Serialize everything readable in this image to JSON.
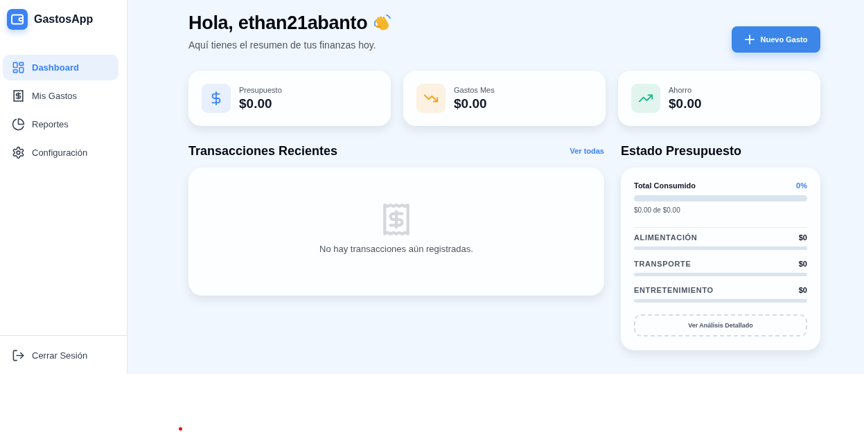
{
  "sidebar": {
    "app_name": "GastosApp",
    "items": [
      {
        "kind": "dashboard",
        "label": "Dashboard",
        "selected": true
      },
      {
        "kind": "expenses",
        "label": "Mis Gastos",
        "selected": false
      },
      {
        "kind": "reports",
        "label": "Reportes",
        "selected": false
      },
      {
        "kind": "settings",
        "label": "Configuración",
        "selected": false
      }
    ],
    "logout": {
      "label": "Cerrar Sesión"
    }
  },
  "header": {
    "greeting": "Hola, ethan21abanto",
    "subtitle": "Aquí tienes el resumen de tus finanzas hoy.",
    "new_button": "Nuevo Gasto"
  },
  "stats": [
    {
      "kind": "budget",
      "label": "Presupuesto",
      "value": "$0.00"
    },
    {
      "kind": "expenses",
      "label": "Gastos Mes",
      "value": "$0.00"
    },
    {
      "kind": "savings",
      "label": "Ahorro",
      "value": "$0.00"
    }
  ],
  "transactions": {
    "title": "Transacciones Recientes",
    "link": "Ver todas",
    "empty_message": "No hay transacciones aún registradas."
  },
  "budget": {
    "title": "Estado Presupuesto",
    "total_label": "Total Consumido",
    "percent": "0%",
    "level": 0,
    "summary": "$0.00 de $0.00",
    "categories": [
      {
        "name": "ALIMENTACIÓN",
        "amount": "$0",
        "level": 0
      },
      {
        "name": "TRANSPORTE",
        "amount": "$0",
        "level": 0
      },
      {
        "name": "ENTRETENIMIENTO",
        "amount": "$0",
        "level": 0
      }
    ],
    "details_button": "Ver Análisis Detallado"
  }
}
